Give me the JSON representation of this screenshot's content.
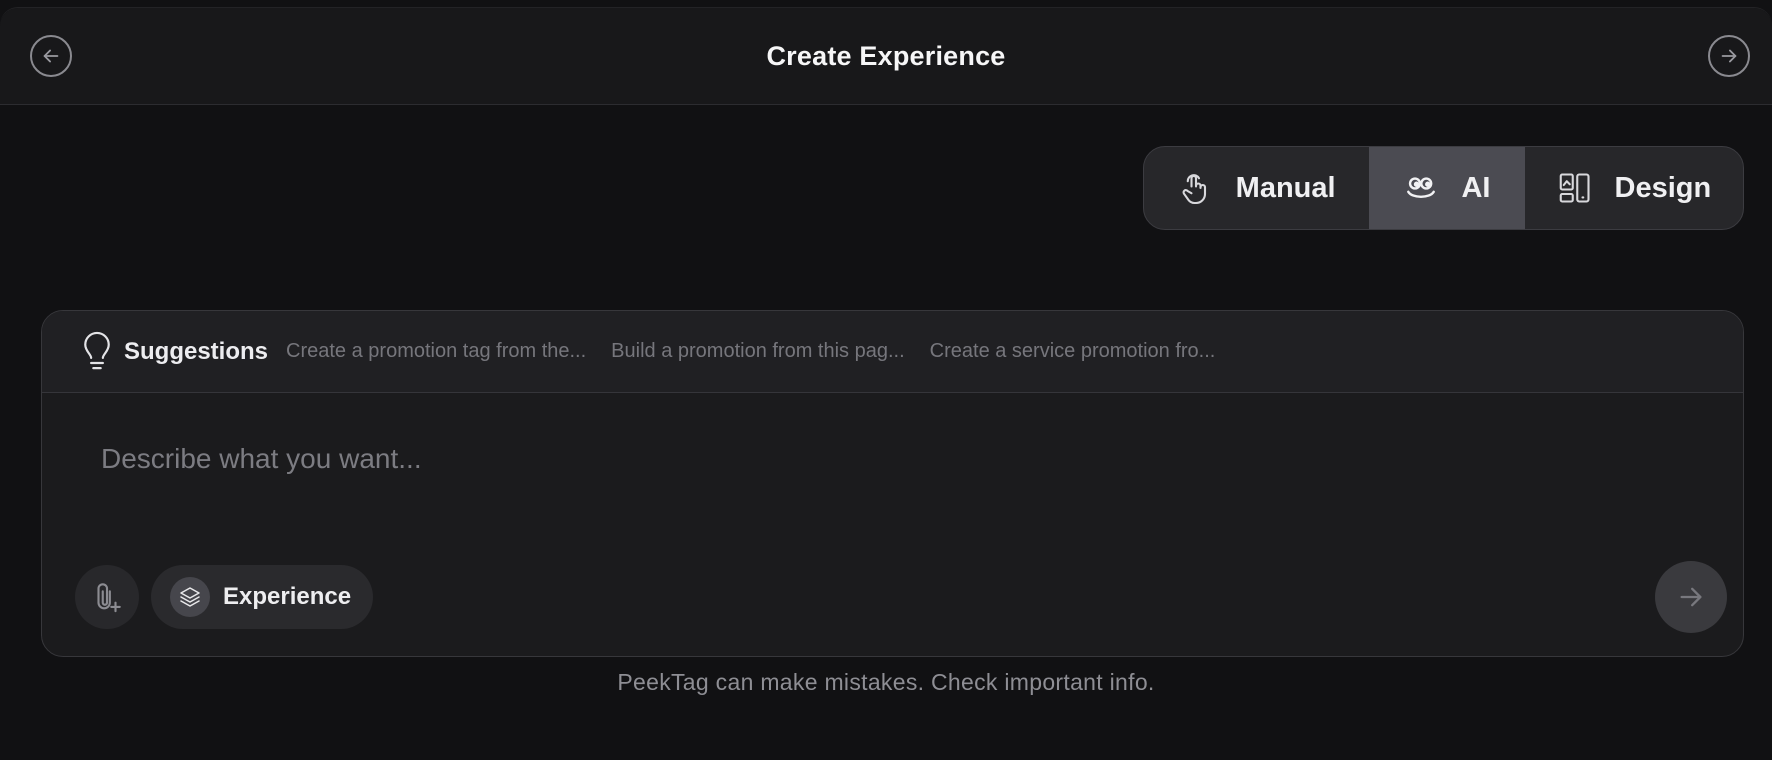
{
  "header": {
    "title": "Create Experience",
    "back_icon": "arrow-left-icon",
    "next_icon": "arrow-right-icon"
  },
  "mode_toggle": {
    "selected": "AI",
    "options": [
      {
        "label": "Manual",
        "icon": "tap-hand-icon"
      },
      {
        "label": "AI",
        "icon": "ai-face-icon"
      },
      {
        "label": "Design",
        "icon": "layout-device-icon"
      }
    ]
  },
  "composer": {
    "suggestions_label": "Suggestions",
    "suggestions": [
      "Create a promotion tag from the...",
      "Build a promotion from this pag...",
      "Create a service promotion fro..."
    ],
    "placeholder": "Describe what you want...",
    "value": "",
    "experience_label": "Experience"
  },
  "footer": {
    "disclaimer": "PeekTag can make mistakes. Check important info."
  },
  "colors": {
    "background": "#111113",
    "surface": "#1b1b1d",
    "selected_mode": "#4b4b52",
    "muted_text": "#76767c"
  }
}
